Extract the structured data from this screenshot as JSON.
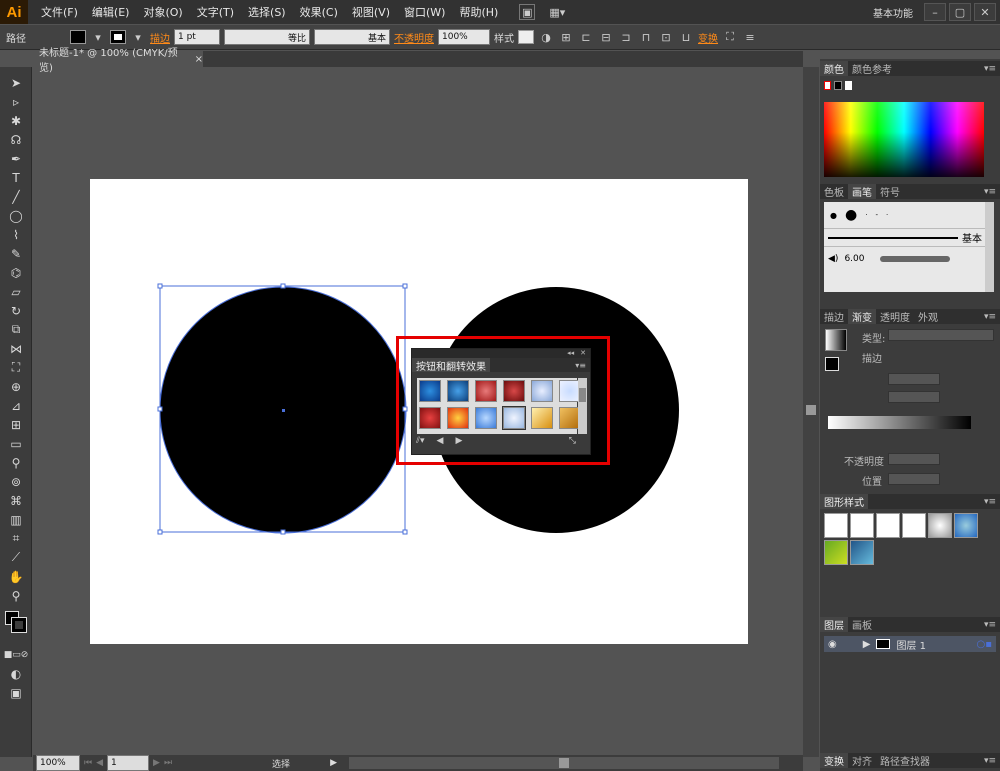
{
  "app": {
    "logo": "Ai",
    "workspace": "基本功能"
  },
  "menu": [
    "文件(F)",
    "编辑(E)",
    "对象(O)",
    "文字(T)",
    "选择(S)",
    "效果(C)",
    "视图(V)",
    "窗口(W)",
    "帮助(H)"
  ],
  "window_controls": [
    "–",
    "▢",
    "✕"
  ],
  "controlbar": {
    "selection": "路径",
    "stroke_label": "描边",
    "stroke_weight": "1 pt",
    "profile": "等比",
    "brush": "基本",
    "opacity_label": "不透明度",
    "opacity": "100%",
    "style_label": "样式",
    "transform": "变换"
  },
  "doc_tab": {
    "title": "未标题-1* @ 100% (CMYK/预览)",
    "close": "×"
  },
  "status": {
    "zoom": "100%",
    "artboard": "1",
    "mode": "选择"
  },
  "float_panel": {
    "title": "按钮和翻转效果",
    "collapse": "◂◂",
    "close": "✕",
    "menu": "▾≡"
  },
  "color_panel": {
    "tabs": [
      "颜色",
      "颜色参考"
    ],
    "active": 0
  },
  "brush_panel": {
    "tabs": [
      "色板",
      "画笔",
      "符号"
    ],
    "active": 1,
    "basic": "基本",
    "size": "6.00"
  },
  "stroke_panel": {
    "tabs": [
      "描边",
      "渐变",
      "透明度",
      "外观"
    ],
    "active": 1,
    "type_label": "类型:",
    "stroke_label": "描边",
    "opacity_label": "不透明度",
    "position_label": "位置"
  },
  "graphic_styles": {
    "title": "图形样式"
  },
  "layers_panel": {
    "tabs": [
      "图层",
      "画板"
    ],
    "layer_name": "图层 1"
  },
  "bottom_tabs": [
    "变换",
    "对齐",
    "路径查找器"
  ],
  "colors": {
    "highlight": "#e50000",
    "selection": "#4a6fd8",
    "accent": "#ff8a18"
  }
}
